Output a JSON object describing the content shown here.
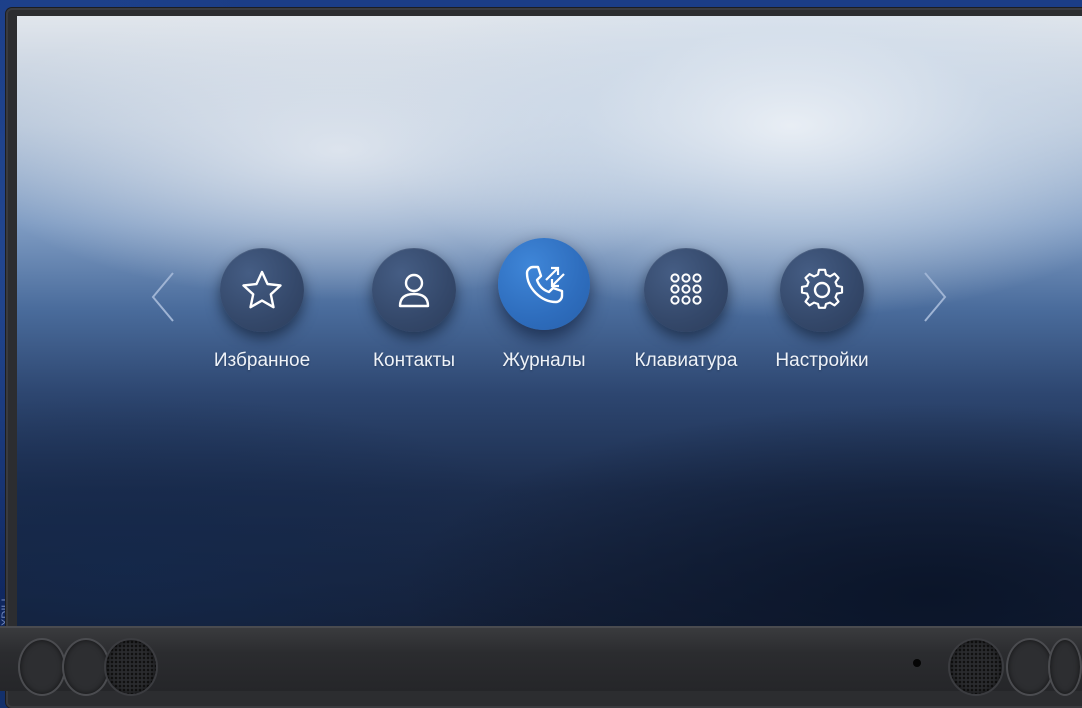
{
  "side_text": "TYXDILI",
  "launcher": {
    "apps": [
      {
        "label": "Избранное",
        "icon": "star-icon",
        "active": false
      },
      {
        "label": "Контакты",
        "icon": "person-icon",
        "active": false
      },
      {
        "label": "Журналы",
        "icon": "phone-calls-icon",
        "active": true
      },
      {
        "label": "Клавиатура",
        "icon": "dialpad-icon",
        "active": false
      },
      {
        "label": "Настройки",
        "icon": "gear-icon",
        "active": false
      }
    ],
    "prev_icon": "chevron-left-icon",
    "next_icon": "chevron-right-icon"
  },
  "colors": {
    "active_accent": "#2e6dbd",
    "inactive_circle": "#34486a",
    "label_text": "#eef2f8"
  }
}
